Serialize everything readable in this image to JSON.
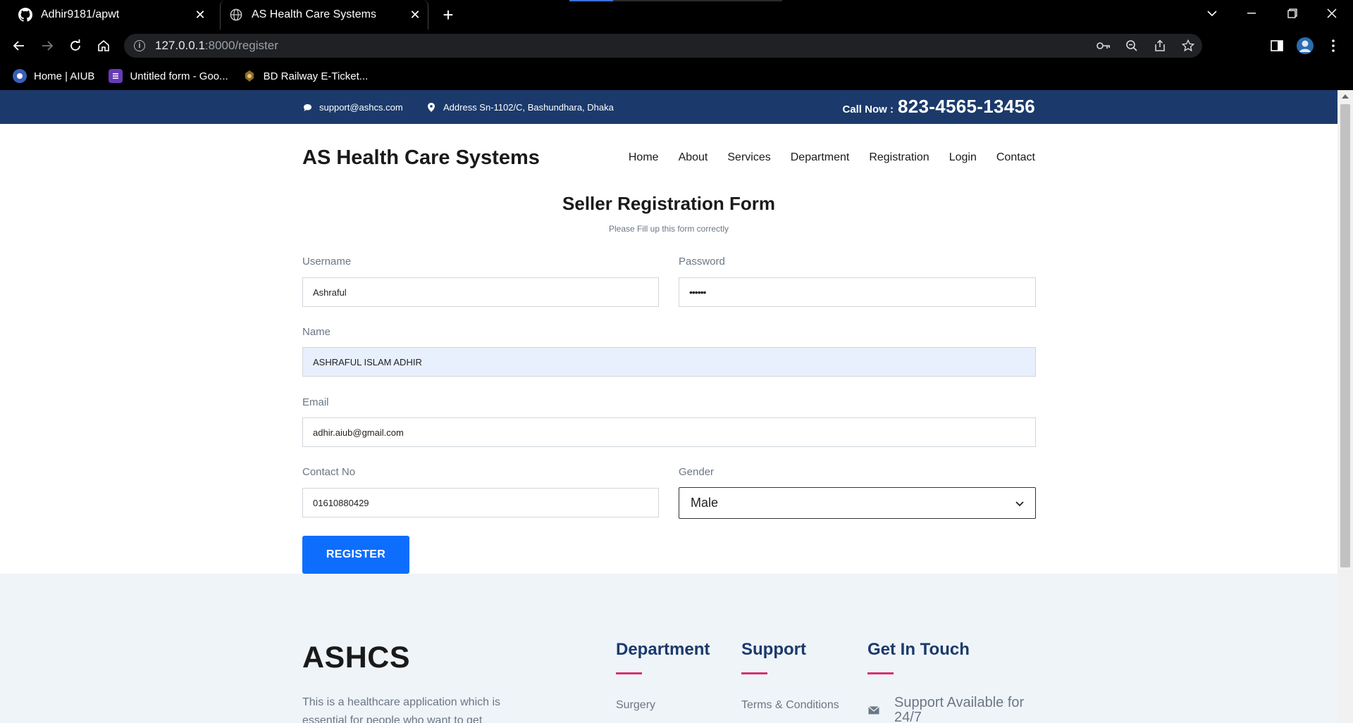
{
  "browser": {
    "tabs": [
      {
        "title": "Adhir9181/apwt",
        "icon": "github-icon"
      },
      {
        "title": "AS Health Care Systems",
        "icon": "globe-icon"
      }
    ],
    "url_host": "127.0.0.1",
    "url_rest": ":8000/register",
    "bookmarks": [
      {
        "label": "Home | AIUB",
        "icon": "aiub-icon"
      },
      {
        "label": "Untitled form - Goo...",
        "icon": "google-forms-icon"
      },
      {
        "label": "BD Railway E-Ticket...",
        "icon": "railway-icon"
      }
    ]
  },
  "topbar": {
    "email": "support@ashcs.com",
    "address": "Address Sn-1102/C, Bashundhara, Dhaka",
    "call_label": "Call Now :",
    "call_number": "823-4565-13456"
  },
  "header": {
    "brand": "AS Health Care Systems",
    "nav": [
      "Home",
      "About",
      "Services",
      "Department",
      "Registration",
      "Login",
      "Contact"
    ]
  },
  "form": {
    "title": "Seller Registration Form",
    "subtitle": "Please Fill up this form correctly",
    "username_label": "Username",
    "username_value": "Ashraful",
    "password_label": "Password",
    "password_value": "••••••",
    "name_label": "Name",
    "name_value": "ASHRAFUL ISLAM ADHIR",
    "email_label": "Email",
    "email_value": "adhir.aiub@gmail.com",
    "contact_label": "Contact No",
    "contact_value": "01610880429",
    "gender_label": "Gender",
    "gender_value": "Male",
    "submit_label": "REGISTER"
  },
  "footer": {
    "brand": "ASHCS",
    "description": "This is a healthcare application which is essential for people who want to get treatment",
    "department_heading": "Department",
    "department_links": [
      "Surgery"
    ],
    "support_heading": "Support",
    "support_links": [
      "Terms & Conditions"
    ],
    "touch_heading": "Get In Touch",
    "touch_text": "Support Available for 24/7"
  },
  "colors": {
    "topbar_bg": "#1b3a6b",
    "button_blue": "#0d6efd",
    "footer_accent": "#d6336c",
    "footer_bg": "#eff4f8"
  }
}
